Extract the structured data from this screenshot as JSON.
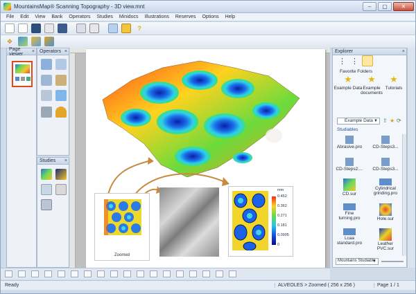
{
  "window": {
    "title": "MountainsMap® Scanning Topography - 3D view.mnt"
  },
  "menu": [
    "File",
    "Edit",
    "View",
    "Bank",
    "Operators",
    "Studies",
    "Minidocs",
    "Illustrations",
    "Reserves",
    "Options",
    "Help"
  ],
  "panels": {
    "page_viewer": "Page viewer",
    "operators": "Operators",
    "studies": "Studies",
    "explorer": "Explorer"
  },
  "explorer": {
    "favorite_folders_label": "Favorite Folders",
    "favorites": [
      "Example Data",
      "Example documents",
      "Tutorials"
    ],
    "folder_select": "Example Data",
    "studiables_label": "Studiables",
    "files": [
      "Abrasive.pro",
      "CD-Steps3...",
      "CD-Steps2....",
      "CD-Steps3...",
      "CD.sur",
      "Cylindrical grinding.pro",
      "Fine turning.pro",
      "Hole.sur",
      "Lcaa standard.pro",
      "Leather PVC.sur"
    ],
    "bottom_select": "Mountains Studiable"
  },
  "document": {
    "thumb_caption": "Zoomed",
    "legend_unit": "mm",
    "legend_values": [
      "0.452",
      "0.362",
      "0.271",
      "0.181",
      "0.0905",
      "0"
    ]
  },
  "status": {
    "left": "Ready",
    "middle": "ALVEOLES > Zoomed ( 256 x 256 )",
    "right": "Page 1 / 1"
  },
  "colors": {
    "accent": "#2d6fd6",
    "arrow": "#c98a3e"
  }
}
